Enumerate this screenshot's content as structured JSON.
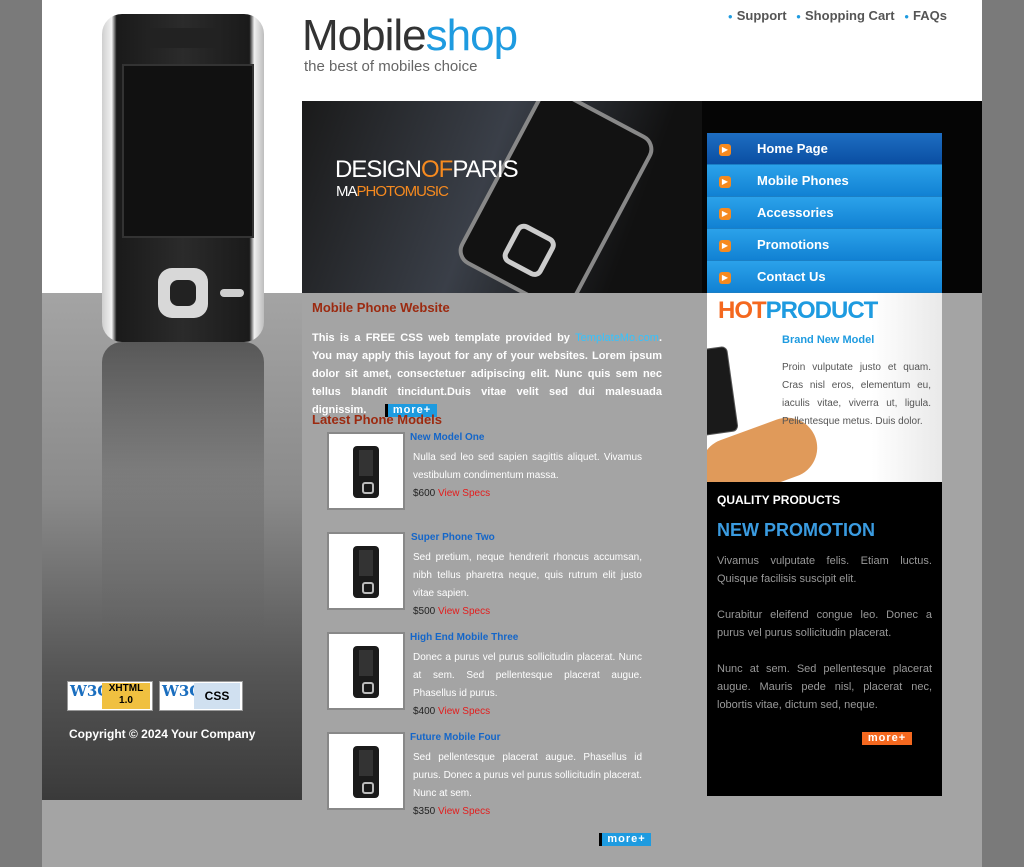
{
  "header": {
    "logo_main": "Mobile",
    "logo_accent": "shop",
    "tagline": "the best of mobiles choice",
    "links": [
      "Support",
      "Shopping Cart",
      "FAQs"
    ]
  },
  "banner": {
    "brand_line1_a": "DESIGN",
    "brand_line1_b": "OF",
    "brand_line1_c": "PARIS",
    "brand_line2_a": "MA",
    "brand_line2_b": "PHOTO",
    "brand_line2_c": "MUSIC"
  },
  "nav": {
    "items": [
      "Home Page",
      "Mobile Phones",
      "Accessories",
      "Promotions",
      "Contact Us"
    ]
  },
  "main": {
    "heading": "Mobile Phone Website",
    "intro_before": "This is a FREE CSS web template provided by ",
    "intro_link": "TemplateMo.com",
    "intro_after": ". You may apply this layout for any of your websites. Lorem ipsum dolor sit amet, consectetuer adipiscing elit. Nunc quis sem nec tellus blandit tincidunt.Duis vitae velit sed dui malesuada dignissim.",
    "more_label": "more+",
    "latest_heading": "Latest Phone Models",
    "products": [
      {
        "title": "New Model One",
        "desc": "Nulla sed leo sed sapien sagittis aliquet. Vivamus vestibulum condimentum massa.",
        "price": "$600",
        "link": "View Specs"
      },
      {
        "title": "Super Phone Two",
        "desc": "Sed pretium, neque hendrerit rhoncus accumsan, nibh tellus pharetra neque, quis rutrum elit justo vitae sapien.",
        "price": "$500",
        "link": "View Specs"
      },
      {
        "title": "High End Mobile Three",
        "desc": "Donec a purus vel purus sollicitudin placerat. Nunc at sem. Sed pellentesque placerat augue. Phasellus id purus.",
        "price": "$400",
        "link": "View Specs"
      },
      {
        "title": "Future Mobile Four",
        "desc": "Sed pellentesque placerat augue. Phasellus id purus. Donec a purus vel purus sollicitudin placerat. Nunc at sem.",
        "price": "$350",
        "link": "View Specs"
      }
    ]
  },
  "hot": {
    "title_a": "HOT",
    "title_b": "PRODUCT",
    "subtitle": "Brand New Model",
    "desc": "Proin vulputate justo et quam. Cras nisl eros, elementum eu, iaculis vitae, viverra ut, ligula. Pellentesque metus. Duis dolor."
  },
  "promo": {
    "quality": "QUALITY PRODUCTS",
    "title": "NEW PROMOTION",
    "p1": "Vivamus vulputate felis. Etiam luctus. Quisque facilisis suscipit elit.",
    "p2": "Curabitur eleifend congue leo. Donec a purus vel purus sollicitudin placerat.",
    "p3": "Nunc at sem. Sed pellentesque placerat augue. Mauris pede nisl, placerat nec, lobortis vitae, dictum sed, neque.",
    "more_label": "more+"
  },
  "footer": {
    "badge_w3c": "W3C",
    "badge_xhtml": "XHTML 1.0",
    "badge_css": "CSS",
    "copyright": "Copyright © 2024 Your Company"
  },
  "colors": {
    "accent_blue": "#1e9be0",
    "accent_orange": "#f4681f",
    "heading_red": "#9c2a10"
  }
}
